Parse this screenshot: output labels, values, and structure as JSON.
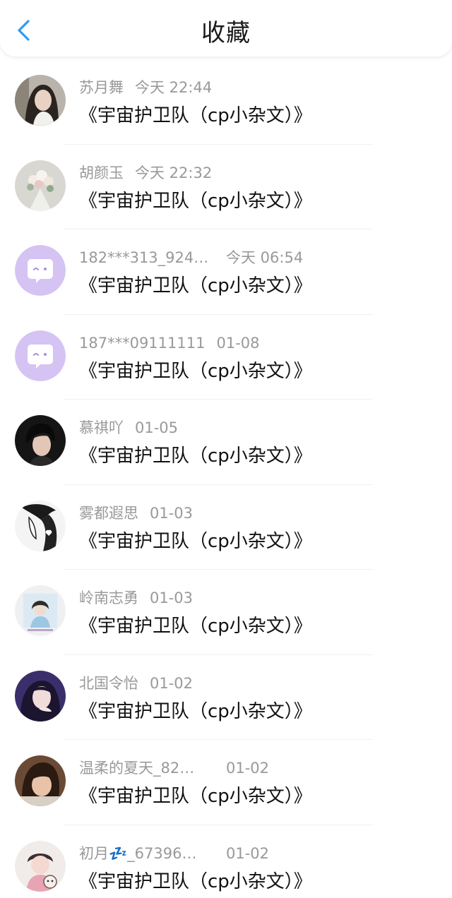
{
  "header": {
    "title": "收藏",
    "back_icon": "chevron-left-icon",
    "accent_color": "#2f9bf0"
  },
  "favorites": [
    {
      "author": "苏月舞",
      "time": "今天 22:44",
      "title": "《宇宙护卫队（cp小杂文）》",
      "avatar": "photo"
    },
    {
      "author": "胡颜玉",
      "time": "今天 22:32",
      "title": "《宇宙护卫队（cp小杂文）》",
      "avatar": "photo"
    },
    {
      "author": "182***313_924…",
      "time": "今天 06:54",
      "title": "《宇宙护卫队（cp小杂文）》",
      "avatar": "default-chat-icon"
    },
    {
      "author": "187***09111111",
      "time": "01-08",
      "title": "《宇宙护卫队（cp小杂文）》",
      "avatar": "default-chat-icon"
    },
    {
      "author": "慕祺吖",
      "time": "01-05",
      "title": "《宇宙护卫队（cp小杂文）》",
      "avatar": "photo"
    },
    {
      "author": "雾都遐思",
      "time": "01-03",
      "title": "《宇宙护卫队（cp小杂文）》",
      "avatar": "photo"
    },
    {
      "author": "岭南志勇",
      "time": "01-03",
      "title": "《宇宙护卫队（cp小杂文）》",
      "avatar": "photo"
    },
    {
      "author": "北国令怡",
      "time": "01-02",
      "title": "《宇宙护卫队（cp小杂文）》",
      "avatar": "photo"
    },
    {
      "author": "温柔的夏天_82…",
      "time": "01-02",
      "title": "《宇宙护卫队（cp小杂文）》",
      "avatar": "photo"
    },
    {
      "author": "初月💤_67396…",
      "time": "01-02",
      "title": "《宇宙护卫队（cp小杂文）》",
      "avatar": "photo"
    }
  ]
}
